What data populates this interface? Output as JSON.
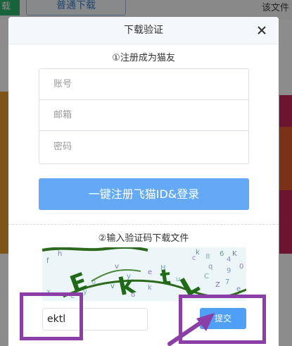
{
  "background": {
    "left_tab": "载",
    "normal_download": "普通下载",
    "right_text": "该文件"
  },
  "dialog": {
    "title": "下载验证",
    "close_icon": "close-icon",
    "register_section_title": "①注册成为猫友",
    "fields": {
      "account_placeholder": "账号",
      "email_placeholder": "邮箱",
      "password_placeholder": "密码"
    },
    "register_button": "一键注册飞猫ID&登录",
    "verify_section_title": "②输入验证码下载文件",
    "captcha_text": "EktL",
    "code_value": "ektl",
    "submit_button": "提交"
  },
  "annotation": {
    "highlight_color": "#8b3fa6"
  }
}
